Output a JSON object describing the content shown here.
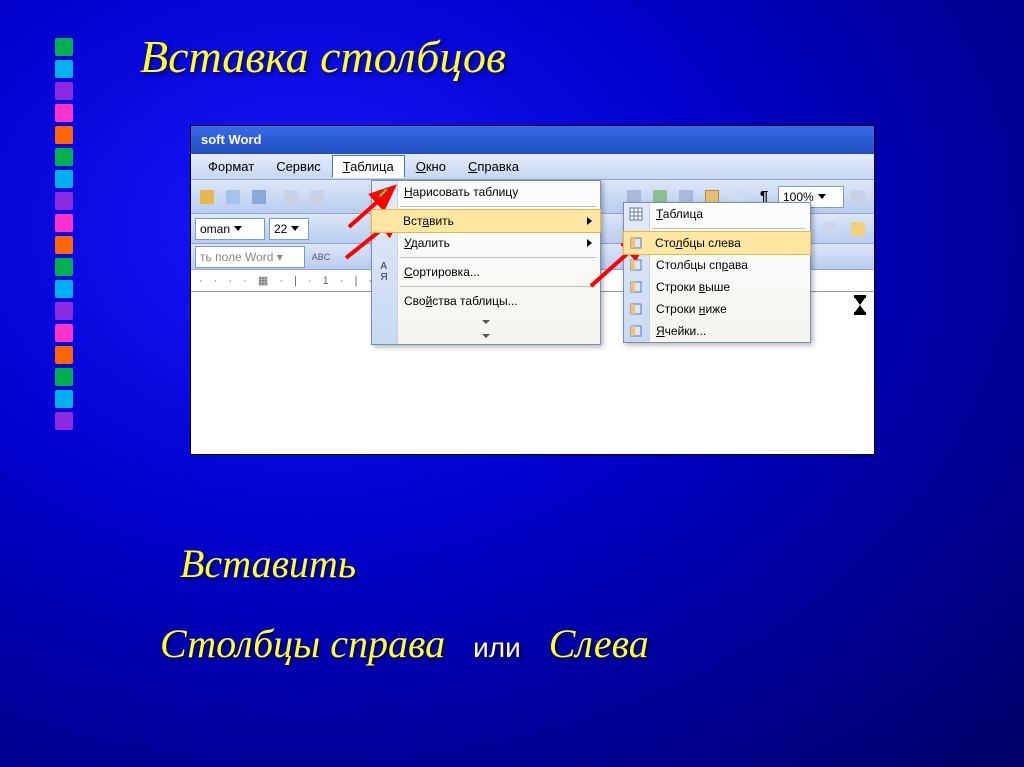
{
  "slide": {
    "title": "Вставка столбцов",
    "caption_insert": "Вставить",
    "caption_right": "Столбцы справа",
    "caption_or": "или",
    "caption_left": "Слева",
    "bullet_colors": [
      "#00b050",
      "#00b0f0",
      "#8a2be2",
      "#ff33cc",
      "#ff6600",
      "#00b050",
      "#00b0f0",
      "#8a2be2",
      "#ff33cc",
      "#ff6600",
      "#00b050",
      "#00b0f0",
      "#8a2be2",
      "#ff33cc",
      "#ff6600",
      "#00b050",
      "#00b0f0",
      "#8a2be2"
    ]
  },
  "word": {
    "title_fragment": "soft Word",
    "menubar": [
      "Формат",
      "Сервис",
      "Таблица",
      "Окно",
      "Справка"
    ],
    "menubar_underline": [
      "",
      "",
      "Т",
      "О",
      "С"
    ],
    "font_combo": "oman",
    "size_combo": "22",
    "zoom": "100%",
    "field_btn": "ть поле Word",
    "ruler": "· · · · ▦ · | · 1 · | · 2 ·",
    "table_menu": [
      {
        "label": "Нарисовать таблицу",
        "u": "Н",
        "icon": "pencil"
      },
      {
        "label": "Вставить",
        "u": "а",
        "icon": "",
        "arrow": true,
        "hover": true
      },
      {
        "label": "Удалить",
        "u": "У",
        "icon": "",
        "arrow": true
      },
      {
        "label": "Сортировка...",
        "u": "С",
        "icon": "sort"
      },
      {
        "label": "Свойства таблицы...",
        "u": "й",
        "icon": ""
      }
    ],
    "insert_submenu": [
      {
        "label": "Таблица",
        "u": "Т",
        "icon": "table"
      },
      {
        "label": "Столбцы слева",
        "u": "л",
        "icon": "col-left",
        "hover": true
      },
      {
        "label": "Столбцы справа",
        "u": "р",
        "icon": "col-right"
      },
      {
        "label": "Строки выше",
        "u": "в",
        "icon": "row-above"
      },
      {
        "label": "Строки ниже",
        "u": "н",
        "icon": "row-below"
      },
      {
        "label": "Ячейки...",
        "u": "Я",
        "icon": "cells"
      }
    ]
  }
}
